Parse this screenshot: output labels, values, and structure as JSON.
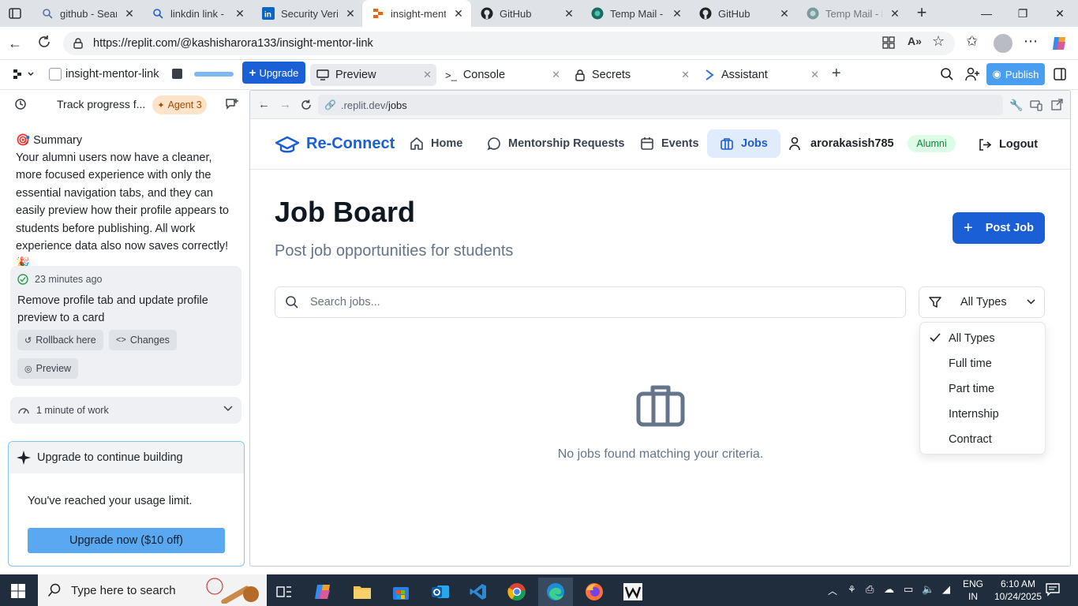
{
  "browser": {
    "tabs": [
      {
        "title": "github - Search",
        "icon": "search-icon",
        "active": false
      },
      {
        "title": "linkdin link - Search",
        "icon": "search-icon",
        "active": false
      },
      {
        "title": "Security Verification",
        "icon": "linkedin-icon",
        "active": false
      },
      {
        "title": "insight-mentor-link",
        "icon": "replit-icon",
        "active": true
      },
      {
        "title": "GitHub",
        "icon": "github-icon",
        "active": false
      },
      {
        "title": "Temp Mail - Disposable",
        "icon": "tempmail-icon",
        "active": false
      },
      {
        "title": "GitHub",
        "icon": "github-icon",
        "active": false
      },
      {
        "title": "Temp Mail - Disposable",
        "icon": "tempmail-icon",
        "active": false
      }
    ],
    "url": "https://replit.com/@kashisharora133/insight-mentor-link"
  },
  "replit": {
    "project_name": "insight-mentor-link",
    "upgrade_label": "Upgrade",
    "tabs": [
      {
        "label": "Preview",
        "icon": "monitor-icon"
      },
      {
        "label": "Console",
        "icon": "terminal-icon"
      },
      {
        "label": "Secrets",
        "icon": "lock-icon"
      },
      {
        "label": "Assistant",
        "icon": "assistant-icon"
      }
    ],
    "publish_label": "Publish"
  },
  "agent": {
    "thread_title": "Track progress f...",
    "agent_badge": "Agent 3",
    "summary_heading": "🎯 Summary",
    "summary_text": "Your alumni users now have a cleaner, more focused experience with only the essential navigation tabs, and they can easily preview how their profile appears to students before publishing. All work experience data also now saves correctly! 🎉",
    "checkpoint": {
      "time": "23 minutes ago",
      "title": "Remove profile tab and update profile preview to a card",
      "rollback_label": "Rollback here",
      "changes_label": "Changes",
      "preview_label": "Preview"
    },
    "work_label": "1 minute of work",
    "upgrade_card": {
      "title": "Upgrade to continue building",
      "message": "You've reached your usage limit.",
      "button": "Upgrade now ($10 off)"
    }
  },
  "preview": {
    "url_prefix": ".replit.dev/",
    "url_path": "jobs",
    "app": {
      "brand": "Re-Connect",
      "nav": [
        {
          "label": "Home",
          "icon": "home-icon"
        },
        {
          "label": "Mentorship Requests",
          "icon": "chat-icon"
        },
        {
          "label": "Events",
          "icon": "calendar-icon"
        },
        {
          "label": "Jobs",
          "icon": "briefcase-icon",
          "active": true
        }
      ],
      "username": "arorakasish785",
      "role_badge": "Alumni",
      "logout_label": "Logout",
      "page_title": "Job Board",
      "page_subtitle": "Post job opportunities for students",
      "post_job_label": "Post Job",
      "search_placeholder": "Search jobs...",
      "filter_selected": "All Types",
      "filter_options": [
        "All Types",
        "Full time",
        "Part time",
        "Internship",
        "Contract"
      ],
      "empty_message": "No jobs found matching your criteria."
    }
  },
  "taskbar": {
    "search_placeholder": "Type here to search",
    "language_line1": "ENG",
    "language_line2": "IN",
    "time": "6:10 AM",
    "date": "10/24/2025"
  },
  "colors": {
    "primary": "#1a5fd6",
    "alumni_badge_bg": "#dcfce7",
    "alumni_badge_text": "#15803d",
    "agent_badge_bg": "#fde4c8",
    "upgrade_button": "#5aa9f0",
    "taskbar": "#1f2d3d"
  }
}
